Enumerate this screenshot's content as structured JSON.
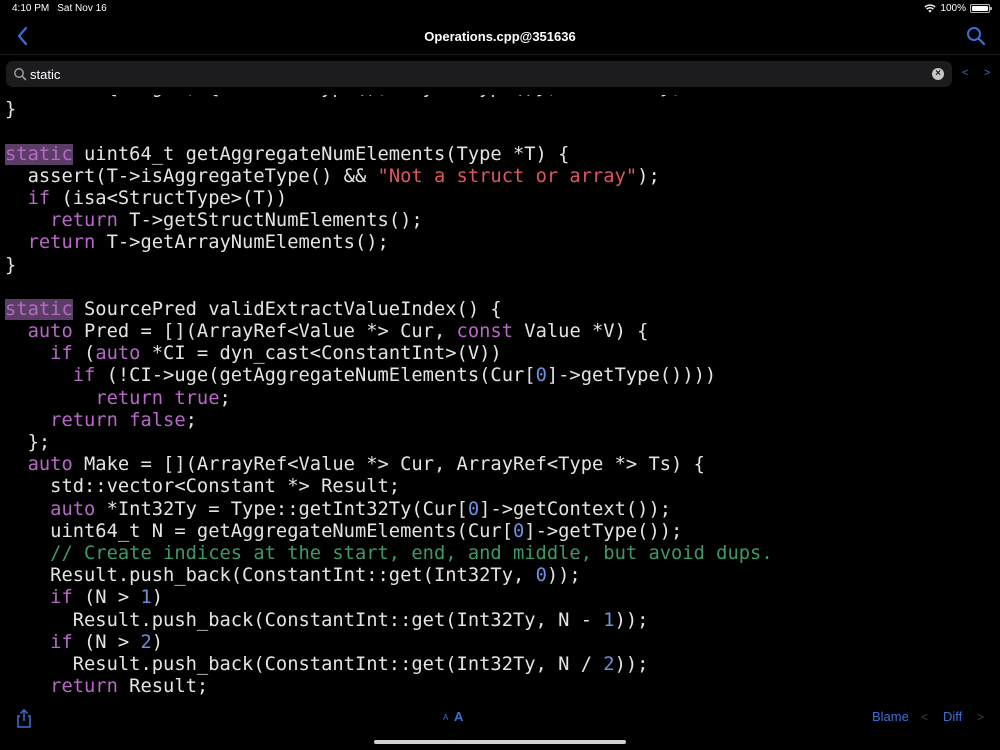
{
  "status_bar": {
    "time": "4:10 PM",
    "date": "Sat Nov 16",
    "battery": "100%",
    "battery_level": 1.0
  },
  "nav": {
    "title": "Operations.cpp@351636",
    "back_icon": "chevron-left-icon",
    "search_icon": "search-icon"
  },
  "search": {
    "value": "static",
    "prev": "<",
    "next": ">"
  },
  "code_lines": [
    [
      {
        "t": "  return {Weight, {sizedPtrType(), anyIntType()}, buildGEP};"
      }
    ],
    [
      {
        "t": "}"
      }
    ],
    [
      {
        "t": ""
      }
    ],
    [
      {
        "t": "static",
        "c": "kw hl"
      },
      {
        "t": " uint64_t getAggregateNumElements(Type *T) {"
      }
    ],
    [
      {
        "t": "  assert(T->isAggregateType() && "
      },
      {
        "t": "\"Not a struct or array\"",
        "c": "str"
      },
      {
        "t": ");"
      }
    ],
    [
      {
        "t": "  "
      },
      {
        "t": "if",
        "c": "kw"
      },
      {
        "t": " (isa<StructType>(T))"
      }
    ],
    [
      {
        "t": "    "
      },
      {
        "t": "return",
        "c": "kw"
      },
      {
        "t": " T->getStructNumElements();"
      }
    ],
    [
      {
        "t": "  "
      },
      {
        "t": "return",
        "c": "kw"
      },
      {
        "t": " T->getArrayNumElements();"
      }
    ],
    [
      {
        "t": "}"
      }
    ],
    [
      {
        "t": ""
      }
    ],
    [
      {
        "t": "static",
        "c": "kw hl"
      },
      {
        "t": " SourcePred validExtractValueIndex() {"
      }
    ],
    [
      {
        "t": "  "
      },
      {
        "t": "auto",
        "c": "kw"
      },
      {
        "t": " Pred = [](ArrayRef<Value *> Cur, "
      },
      {
        "t": "const",
        "c": "kw"
      },
      {
        "t": " Value *V) {"
      }
    ],
    [
      {
        "t": "    "
      },
      {
        "t": "if",
        "c": "kw"
      },
      {
        "t": " ("
      },
      {
        "t": "auto",
        "c": "kw"
      },
      {
        "t": " *CI = dyn_cast<ConstantInt>(V))"
      }
    ],
    [
      {
        "t": "      "
      },
      {
        "t": "if",
        "c": "kw"
      },
      {
        "t": " (!CI->uge(getAggregateNumElements(Cur["
      },
      {
        "t": "0",
        "c": "num"
      },
      {
        "t": "]->getType())))"
      }
    ],
    [
      {
        "t": "        "
      },
      {
        "t": "return",
        "c": "kw"
      },
      {
        "t": " "
      },
      {
        "t": "true",
        "c": "kw"
      },
      {
        "t": ";"
      }
    ],
    [
      {
        "t": "    "
      },
      {
        "t": "return",
        "c": "kw"
      },
      {
        "t": " "
      },
      {
        "t": "false",
        "c": "kw"
      },
      {
        "t": ";"
      }
    ],
    [
      {
        "t": "  };"
      }
    ],
    [
      {
        "t": "  "
      },
      {
        "t": "auto",
        "c": "kw"
      },
      {
        "t": " Make = [](ArrayRef<Value *> Cur, ArrayRef<Type *> Ts) {"
      }
    ],
    [
      {
        "t": "    std::vector<Constant *> Result;"
      }
    ],
    [
      {
        "t": "    "
      },
      {
        "t": "auto",
        "c": "kw"
      },
      {
        "t": " *Int32Ty = Type::getInt32Ty(Cur["
      },
      {
        "t": "0",
        "c": "num"
      },
      {
        "t": "]->getContext());"
      }
    ],
    [
      {
        "t": "    uint64_t N = getAggregateNumElements(Cur["
      },
      {
        "t": "0",
        "c": "num"
      },
      {
        "t": "]->getType());"
      }
    ],
    [
      {
        "t": "    "
      },
      {
        "t": "// Create indices at the start, end, and middle, but avoid dups.",
        "c": "cmt"
      }
    ],
    [
      {
        "t": "    Result.push_back(ConstantInt::get(Int32Ty, "
      },
      {
        "t": "0",
        "c": "num"
      },
      {
        "t": "));"
      }
    ],
    [
      {
        "t": "    "
      },
      {
        "t": "if",
        "c": "kw"
      },
      {
        "t": " (N > "
      },
      {
        "t": "1",
        "c": "num"
      },
      {
        "t": ")"
      }
    ],
    [
      {
        "t": "      Result.push_back(ConstantInt::get(Int32Ty, N - "
      },
      {
        "t": "1",
        "c": "num"
      },
      {
        "t": "));"
      }
    ],
    [
      {
        "t": "    "
      },
      {
        "t": "if",
        "c": "kw"
      },
      {
        "t": " (N > "
      },
      {
        "t": "2",
        "c": "num"
      },
      {
        "t": ")"
      }
    ],
    [
      {
        "t": "      Result.push_back(ConstantInt::get(Int32Ty, N / "
      },
      {
        "t": "2",
        "c": "num"
      },
      {
        "t": "));"
      }
    ],
    [
      {
        "t": "    "
      },
      {
        "t": "return",
        "c": "kw"
      },
      {
        "t": " Result;"
      }
    ]
  ],
  "toolbar": {
    "share_icon": "share-icon",
    "font_small": "A",
    "font_large": "A",
    "blame": "Blame",
    "prev": "<",
    "diff": "Diff",
    "next": ">"
  },
  "colors": {
    "accent": "#3a6fd8",
    "keyword": "#b968c7",
    "string": "#e0555f",
    "number": "#6d8fe0",
    "comment": "#3c9a68",
    "search_highlight": "#5a3e66"
  }
}
